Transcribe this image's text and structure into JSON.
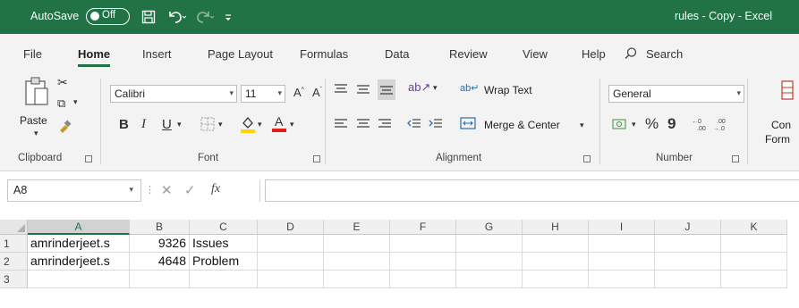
{
  "titlebar": {
    "autosave_label": "AutoSave",
    "autosave_state": "Off",
    "document_title": "rules - Copy  -  Excel",
    "icons": [
      "save-icon",
      "undo-icon",
      "redo-icon",
      "customize-icon"
    ]
  },
  "tabs": [
    {
      "label": "File",
      "active": false
    },
    {
      "label": "Home",
      "active": true
    },
    {
      "label": "Insert",
      "active": false
    },
    {
      "label": "Page Layout",
      "active": false
    },
    {
      "label": "Formulas",
      "active": false
    },
    {
      "label": "Data",
      "active": false
    },
    {
      "label": "Review",
      "active": false
    },
    {
      "label": "View",
      "active": false
    },
    {
      "label": "Help",
      "active": false
    }
  ],
  "search_label": "Search",
  "ribbon": {
    "clipboard": {
      "paste_label": "Paste",
      "group_label": "Clipboard"
    },
    "font": {
      "font_name": "Calibri",
      "font_size": "11",
      "group_label": "Font"
    },
    "alignment": {
      "wrap_text": "Wrap Text",
      "merge_center": "Merge & Center",
      "group_label": "Alignment"
    },
    "number": {
      "format": "General",
      "percent": "%",
      "comma": "9",
      "group_label": "Number"
    },
    "cut_off": {
      "line1": "Con",
      "line2": "Form"
    }
  },
  "formula_bar": {
    "name_box": "A8",
    "formula": "",
    "fx_label": "fx"
  },
  "grid": {
    "columns": [
      "A",
      "B",
      "C",
      "D",
      "E",
      "F",
      "G",
      "H",
      "I",
      "J",
      "K"
    ],
    "selected_column": "A",
    "rows": [
      {
        "num": "1",
        "cells": [
          "amrinderjeet.s",
          "9326",
          "Issues",
          "",
          "",
          "",
          "",
          "",
          "",
          "",
          ""
        ]
      },
      {
        "num": "2",
        "cells": [
          "amrinderjeet.s",
          "4648",
          "Problem",
          "",
          "",
          "",
          "",
          "",
          "",
          "",
          ""
        ]
      },
      {
        "num": "3",
        "cells": [
          "",
          "",
          "",
          "",
          "",
          "",
          "",
          "",
          "",
          "",
          ""
        ]
      }
    ]
  },
  "colors": {
    "accent": "#217346",
    "ribbon_bg": "#f3f3f3",
    "font_highlight": "#ffd400",
    "font_color": "#e21b1b"
  }
}
